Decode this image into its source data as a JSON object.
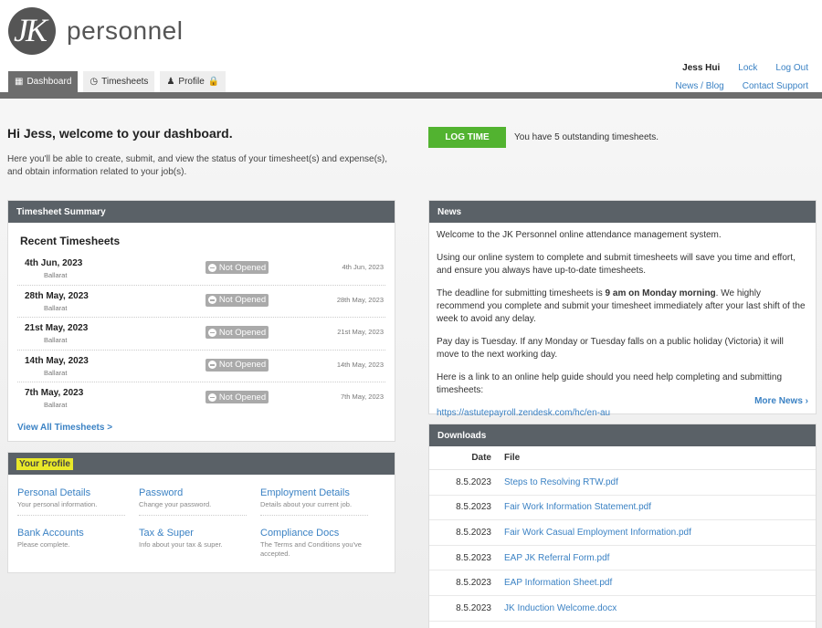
{
  "brand": {
    "logo_initials": "JK",
    "name": "personnel"
  },
  "tabs": [
    {
      "label": "Dashboard",
      "icon": "grid-icon"
    },
    {
      "label": "Timesheets",
      "icon": "clock-icon"
    },
    {
      "label": "Profile",
      "icon": "user-icon",
      "badge_icon": "lock-icon"
    }
  ],
  "user_nav": {
    "username": "Jess Hui",
    "lock": "Lock",
    "logout": "Log Out",
    "news_blog": "News / Blog",
    "contact_support": "Contact Support"
  },
  "welcome": {
    "title": "Hi Jess, welcome to your dashboard.",
    "text": "Here you'll be able to create, submit, and view the status of your timesheet(s) and expense(s), and obtain information related to your job(s)."
  },
  "log_time": {
    "button": "LOG TIME",
    "message": "You have 5 outstanding timesheets."
  },
  "timesheet_summary": {
    "title": "Timesheet Summary",
    "subtitle": "Recent Timesheets",
    "items": [
      {
        "date": "4th Jun, 2023",
        "location": "Ballarat",
        "status": "Not Opened",
        "date_right": "4th Jun, 2023"
      },
      {
        "date": "28th May, 2023",
        "location": "Ballarat",
        "status": "Not Opened",
        "date_right": "28th May, 2023"
      },
      {
        "date": "21st May, 2023",
        "location": "Ballarat",
        "status": "Not Opened",
        "date_right": "21st May, 2023"
      },
      {
        "date": "14th May, 2023",
        "location": "Ballarat",
        "status": "Not Opened",
        "date_right": "14th May, 2023"
      },
      {
        "date": "7th May, 2023",
        "location": "Ballarat",
        "status": "Not Opened",
        "date_right": "7th May, 2023"
      }
    ],
    "view_all": "View All Timesheets >"
  },
  "profile": {
    "title": "Your Profile",
    "items": [
      {
        "title": "Personal Details",
        "sub": "Your personal information."
      },
      {
        "title": "Password",
        "sub": "Change your password."
      },
      {
        "title": "Employment Details",
        "sub": "Details about your current job."
      },
      {
        "title": "Bank Accounts",
        "sub": "Please complete."
      },
      {
        "title": "Tax & Super",
        "sub": "Info about your tax & super."
      },
      {
        "title": "Compliance Docs",
        "sub": "The Terms and Conditions you've accepted."
      }
    ]
  },
  "news": {
    "title": "News",
    "p1": "Welcome to the JK Personnel online attendance management system.",
    "p2": "Using our online system to complete and submit timesheets will save you time and effort, and ensure you always have up-to-date timesheets.",
    "p3a": "The deadline for submitting timesheets is ",
    "p3b": "9 am on Monday morning",
    "p3c": ". We highly recommend you complete and submit your timesheet immediately after your last shift of the week to avoid any delay.",
    "p4": "Pay day is Tuesday. If any Monday or Tuesday falls on a public holiday (Victoria) it will move to the next working day.",
    "p5": "Here is a link to an online help guide should you need help completing and submitting timesheets:",
    "link": "https://astutepayroll.zendesk.com/hc/en-au",
    "more": "More News ›"
  },
  "downloads": {
    "title": "Downloads",
    "col_date": "Date",
    "col_file": "File",
    "rows": [
      {
        "date": "8.5.2023",
        "file": "Steps to Resolving RTW.pdf"
      },
      {
        "date": "8.5.2023",
        "file": "Fair Work Information Statement.pdf"
      },
      {
        "date": "8.5.2023",
        "file": "Fair Work Casual Employment Information.pdf"
      },
      {
        "date": "8.5.2023",
        "file": "EAP JK Referral Form.pdf"
      },
      {
        "date": "8.5.2023",
        "file": "EAP Information Sheet.pdf"
      },
      {
        "date": "8.5.2023",
        "file": "JK Induction Welcome.docx"
      }
    ]
  }
}
